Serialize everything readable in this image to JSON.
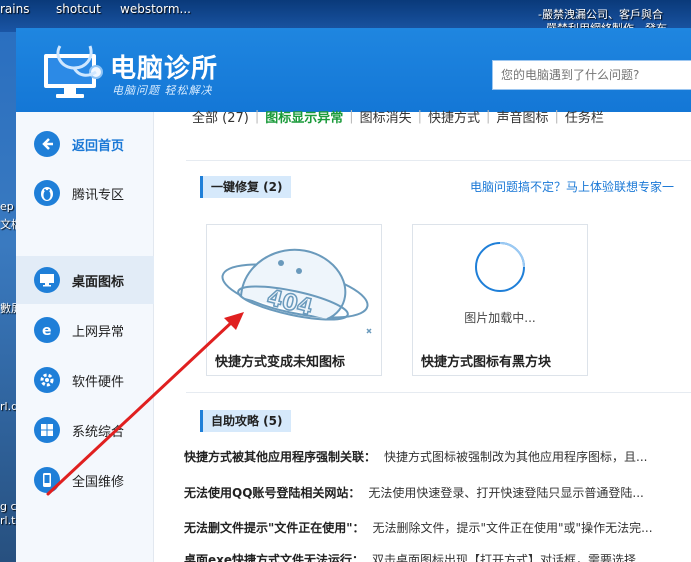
{
  "desktop": {
    "top_items": [
      "rains",
      "shotcut",
      "webstorm..."
    ],
    "top_right_lines": [
      "-嚴禁洩漏公司、客戶與合",
      "嚴禁利用網絡製作、發布"
    ],
    "left_fragments": [
      "ep",
      "文檔",
      "數屏",
      "rl.d",
      "g c",
      "rl.tx"
    ]
  },
  "app": {
    "title": "电脑诊所",
    "slogan": "电脑问题 轻松解决",
    "search_placeholder": "您的电脑遇到了什么问题?"
  },
  "sidebar": {
    "items": [
      {
        "label": "返回首页",
        "icon": "back-arrow-icon"
      },
      {
        "label": "腾讯专区",
        "icon": "penguin-icon"
      },
      {
        "label": "桌面图标",
        "icon": "monitor-icon"
      },
      {
        "label": "上网异常",
        "icon": "browser-icon"
      },
      {
        "label": "软件硬件",
        "icon": "gear-icon"
      },
      {
        "label": "系统综合",
        "icon": "windows-icon"
      },
      {
        "label": "全国维修",
        "icon": "phone-icon"
      }
    ],
    "active_index": 2
  },
  "tabs": [
    {
      "label": "全部 (27)"
    },
    {
      "label": "图标显示异常"
    },
    {
      "label": "图标消失"
    },
    {
      "label": "快捷方式"
    },
    {
      "label": "声音图标"
    },
    {
      "label": "任务栏"
    }
  ],
  "one_click": {
    "heading": "一键修复 (2)",
    "promo_link": "电脑问题搞不定？马上体验联想专家一",
    "cards": [
      {
        "caption": "快捷方式变成未知图标",
        "image_text": "404"
      },
      {
        "caption": "快捷方式图标有黑方块",
        "loading_text": "图片加载中..."
      }
    ]
  },
  "self_help": {
    "heading": "自助攻略 (5)",
    "items": [
      {
        "title": "快捷方式被其他应用程序强制关联：",
        "desc": "快捷方式图标被强制改为其他应用程序图标，且..."
      },
      {
        "title": "无法使用QQ账号登陆相关网站：",
        "desc": "无法使用快速登录、打开快速登陆只显示普通登陆..."
      },
      {
        "title": "无法删文件提示\"文件正在使用\"：",
        "desc": "无法删除文件，提示\"文件正在使用\"或\"操作无法完..."
      },
      {
        "title": "桌面exe快捷方式文件无法运行：",
        "desc": "双击桌面图标出现【打开方式】对话框，需要选择..."
      }
    ]
  },
  "colors": {
    "header_blue": "#1477d6",
    "accent_green": "#1a9a3a",
    "link_blue": "#1a78d6",
    "arrow_red": "#e02020"
  }
}
